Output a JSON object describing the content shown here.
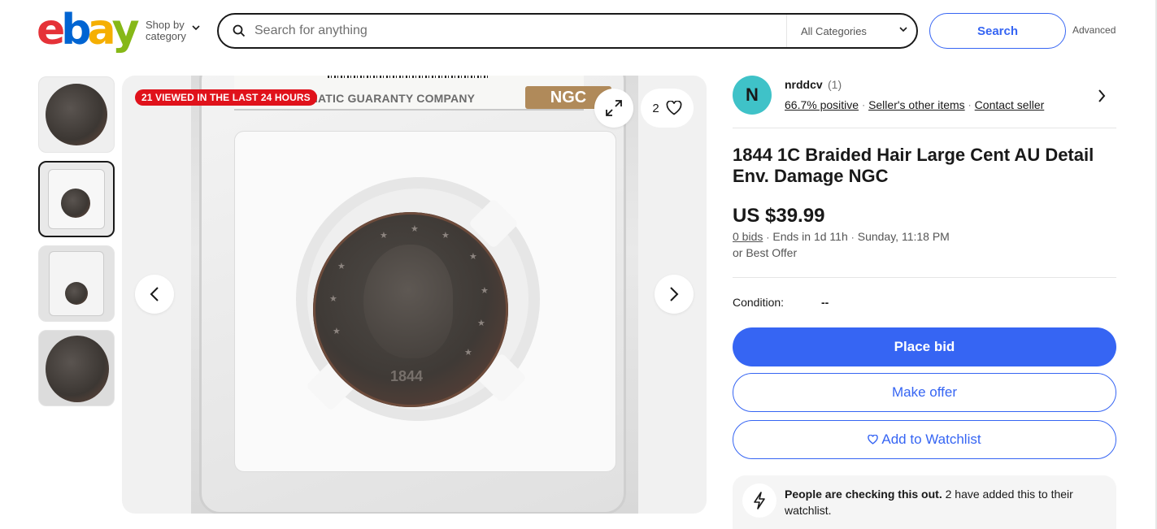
{
  "header": {
    "logo_letters": [
      "e",
      "b",
      "a",
      "y"
    ],
    "logo_colors": [
      "#e53238",
      "#0064d2",
      "#f5af02",
      "#86b817"
    ],
    "shop_by_line1": "Shop by",
    "shop_by_line2": "category",
    "search_placeholder": "Search for anything",
    "category_select": "All Categories",
    "search_button": "Search",
    "advanced_link": "Advanced"
  },
  "gallery": {
    "views_badge": "21 VIEWED IN THE LAST 24 HOURS",
    "watch_count": "2",
    "ngc_label": "NUMISMATIC GUARANTY COMPANY",
    "ngc_logo": "NGC",
    "coin_date": "1844"
  },
  "seller": {
    "avatar_letter": "N",
    "name": "nrddcv",
    "feedback_count": "(1)",
    "positive": "66.7% positive",
    "other_items": "Seller's other items",
    "contact": "Contact seller"
  },
  "item": {
    "title": "1844 1C Braided Hair Large Cent AU Detail Env. Damage NGC",
    "price": "US $39.99",
    "bids": "0 bids",
    "ends_in": "Ends in 1d 11h",
    "ends_at": "Sunday, 11:18 PM",
    "best_offer": "or Best Offer",
    "condition_label": "Condition:",
    "condition_value": "--"
  },
  "actions": {
    "place_bid": "Place bid",
    "make_offer": "Make offer",
    "add_watchlist": "Add to Watchlist"
  },
  "notice": {
    "bold": "People are checking this out.",
    "rest": " 2 have added this to their watchlist."
  },
  "colors": {
    "accent": "#3665f3",
    "badge_red": "#e0121b",
    "avatar_teal": "#3fc2c8"
  }
}
